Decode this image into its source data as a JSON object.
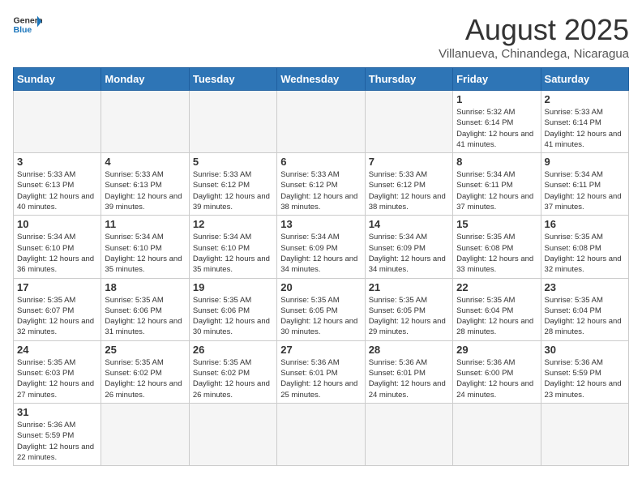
{
  "header": {
    "logo_general": "General",
    "logo_blue": "Blue",
    "main_title": "August 2025",
    "subtitle": "Villanueva, Chinandega, Nicaragua"
  },
  "weekdays": [
    "Sunday",
    "Monday",
    "Tuesday",
    "Wednesday",
    "Thursday",
    "Friday",
    "Saturday"
  ],
  "weeks": [
    [
      {
        "day": "",
        "info": ""
      },
      {
        "day": "",
        "info": ""
      },
      {
        "day": "",
        "info": ""
      },
      {
        "day": "",
        "info": ""
      },
      {
        "day": "",
        "info": ""
      },
      {
        "day": "1",
        "info": "Sunrise: 5:32 AM\nSunset: 6:14 PM\nDaylight: 12 hours and 41 minutes."
      },
      {
        "day": "2",
        "info": "Sunrise: 5:33 AM\nSunset: 6:14 PM\nDaylight: 12 hours and 41 minutes."
      }
    ],
    [
      {
        "day": "3",
        "info": "Sunrise: 5:33 AM\nSunset: 6:13 PM\nDaylight: 12 hours and 40 minutes."
      },
      {
        "day": "4",
        "info": "Sunrise: 5:33 AM\nSunset: 6:13 PM\nDaylight: 12 hours and 39 minutes."
      },
      {
        "day": "5",
        "info": "Sunrise: 5:33 AM\nSunset: 6:12 PM\nDaylight: 12 hours and 39 minutes."
      },
      {
        "day": "6",
        "info": "Sunrise: 5:33 AM\nSunset: 6:12 PM\nDaylight: 12 hours and 38 minutes."
      },
      {
        "day": "7",
        "info": "Sunrise: 5:33 AM\nSunset: 6:12 PM\nDaylight: 12 hours and 38 minutes."
      },
      {
        "day": "8",
        "info": "Sunrise: 5:34 AM\nSunset: 6:11 PM\nDaylight: 12 hours and 37 minutes."
      },
      {
        "day": "9",
        "info": "Sunrise: 5:34 AM\nSunset: 6:11 PM\nDaylight: 12 hours and 37 minutes."
      }
    ],
    [
      {
        "day": "10",
        "info": "Sunrise: 5:34 AM\nSunset: 6:10 PM\nDaylight: 12 hours and 36 minutes."
      },
      {
        "day": "11",
        "info": "Sunrise: 5:34 AM\nSunset: 6:10 PM\nDaylight: 12 hours and 35 minutes."
      },
      {
        "day": "12",
        "info": "Sunrise: 5:34 AM\nSunset: 6:10 PM\nDaylight: 12 hours and 35 minutes."
      },
      {
        "day": "13",
        "info": "Sunrise: 5:34 AM\nSunset: 6:09 PM\nDaylight: 12 hours and 34 minutes."
      },
      {
        "day": "14",
        "info": "Sunrise: 5:34 AM\nSunset: 6:09 PM\nDaylight: 12 hours and 34 minutes."
      },
      {
        "day": "15",
        "info": "Sunrise: 5:35 AM\nSunset: 6:08 PM\nDaylight: 12 hours and 33 minutes."
      },
      {
        "day": "16",
        "info": "Sunrise: 5:35 AM\nSunset: 6:08 PM\nDaylight: 12 hours and 32 minutes."
      }
    ],
    [
      {
        "day": "17",
        "info": "Sunrise: 5:35 AM\nSunset: 6:07 PM\nDaylight: 12 hours and 32 minutes."
      },
      {
        "day": "18",
        "info": "Sunrise: 5:35 AM\nSunset: 6:06 PM\nDaylight: 12 hours and 31 minutes."
      },
      {
        "day": "19",
        "info": "Sunrise: 5:35 AM\nSunset: 6:06 PM\nDaylight: 12 hours and 30 minutes."
      },
      {
        "day": "20",
        "info": "Sunrise: 5:35 AM\nSunset: 6:05 PM\nDaylight: 12 hours and 30 minutes."
      },
      {
        "day": "21",
        "info": "Sunrise: 5:35 AM\nSunset: 6:05 PM\nDaylight: 12 hours and 29 minutes."
      },
      {
        "day": "22",
        "info": "Sunrise: 5:35 AM\nSunset: 6:04 PM\nDaylight: 12 hours and 28 minutes."
      },
      {
        "day": "23",
        "info": "Sunrise: 5:35 AM\nSunset: 6:04 PM\nDaylight: 12 hours and 28 minutes."
      }
    ],
    [
      {
        "day": "24",
        "info": "Sunrise: 5:35 AM\nSunset: 6:03 PM\nDaylight: 12 hours and 27 minutes."
      },
      {
        "day": "25",
        "info": "Sunrise: 5:35 AM\nSunset: 6:02 PM\nDaylight: 12 hours and 26 minutes."
      },
      {
        "day": "26",
        "info": "Sunrise: 5:35 AM\nSunset: 6:02 PM\nDaylight: 12 hours and 26 minutes."
      },
      {
        "day": "27",
        "info": "Sunrise: 5:36 AM\nSunset: 6:01 PM\nDaylight: 12 hours and 25 minutes."
      },
      {
        "day": "28",
        "info": "Sunrise: 5:36 AM\nSunset: 6:01 PM\nDaylight: 12 hours and 24 minutes."
      },
      {
        "day": "29",
        "info": "Sunrise: 5:36 AM\nSunset: 6:00 PM\nDaylight: 12 hours and 24 minutes."
      },
      {
        "day": "30",
        "info": "Sunrise: 5:36 AM\nSunset: 5:59 PM\nDaylight: 12 hours and 23 minutes."
      }
    ],
    [
      {
        "day": "31",
        "info": "Sunrise: 5:36 AM\nSunset: 5:59 PM\nDaylight: 12 hours and 22 minutes."
      },
      {
        "day": "",
        "info": ""
      },
      {
        "day": "",
        "info": ""
      },
      {
        "day": "",
        "info": ""
      },
      {
        "day": "",
        "info": ""
      },
      {
        "day": "",
        "info": ""
      },
      {
        "day": "",
        "info": ""
      }
    ]
  ]
}
